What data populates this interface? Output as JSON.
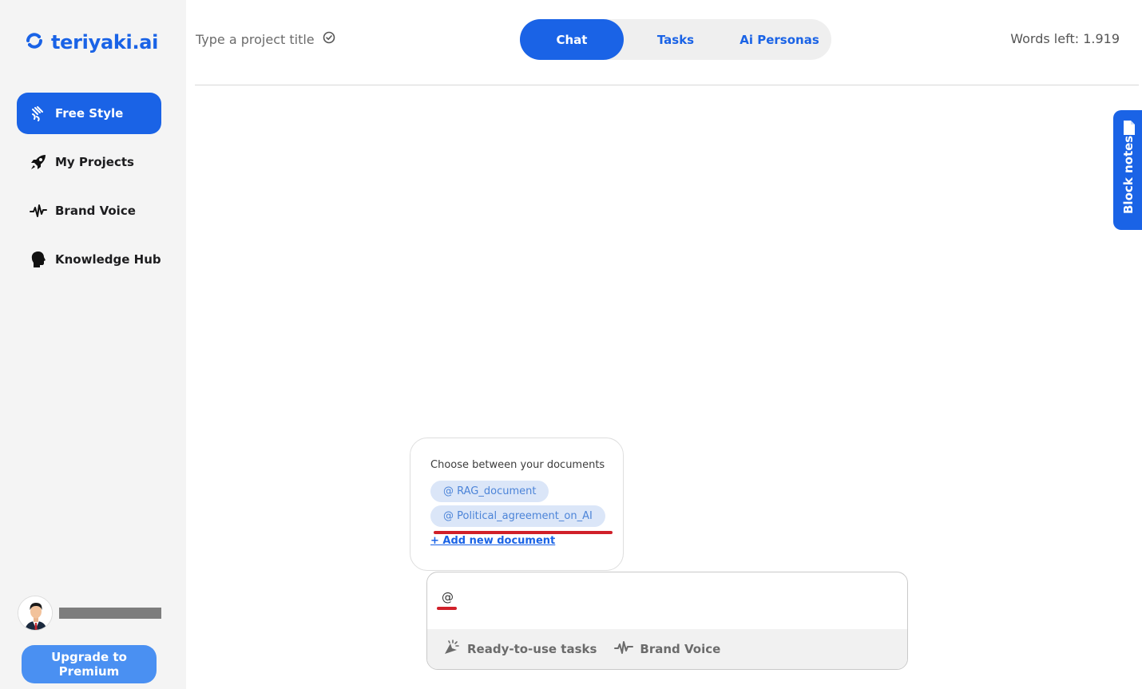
{
  "brand": {
    "name": "teriyaki.ai",
    "color": "#1a63e6"
  },
  "sidebar": {
    "items": [
      {
        "label": "Free Style",
        "icon": "sparkle-wand-icon",
        "active": true
      },
      {
        "label": "My Projects",
        "icon": "rocket-icon",
        "active": false
      },
      {
        "label": "Brand Voice",
        "icon": "waveform-icon",
        "active": false
      },
      {
        "label": "Knowledge Hub",
        "icon": "head-brain-icon",
        "active": false
      }
    ],
    "upgrade_label": "Upgrade to Premium"
  },
  "header": {
    "project_title_placeholder": "Type a project title",
    "tabs": [
      {
        "label": "Chat",
        "active": true
      },
      {
        "label": "Tasks",
        "active": false
      },
      {
        "label": "Ai Personas",
        "active": false
      }
    ],
    "words_left": "Words left: 1.919"
  },
  "block_notes": {
    "label": "Block notes"
  },
  "document_popup": {
    "title": "Choose between your documents",
    "documents": [
      "@ RAG_document",
      "@ Political_agreement_on_AI"
    ],
    "add_label": "+ Add new document"
  },
  "chat_input": {
    "value": "@",
    "tools": [
      {
        "label": "Ready-to-use tasks",
        "icon": "magic-cursor-icon"
      },
      {
        "label": "Brand Voice",
        "icon": "waveform-icon"
      }
    ]
  }
}
